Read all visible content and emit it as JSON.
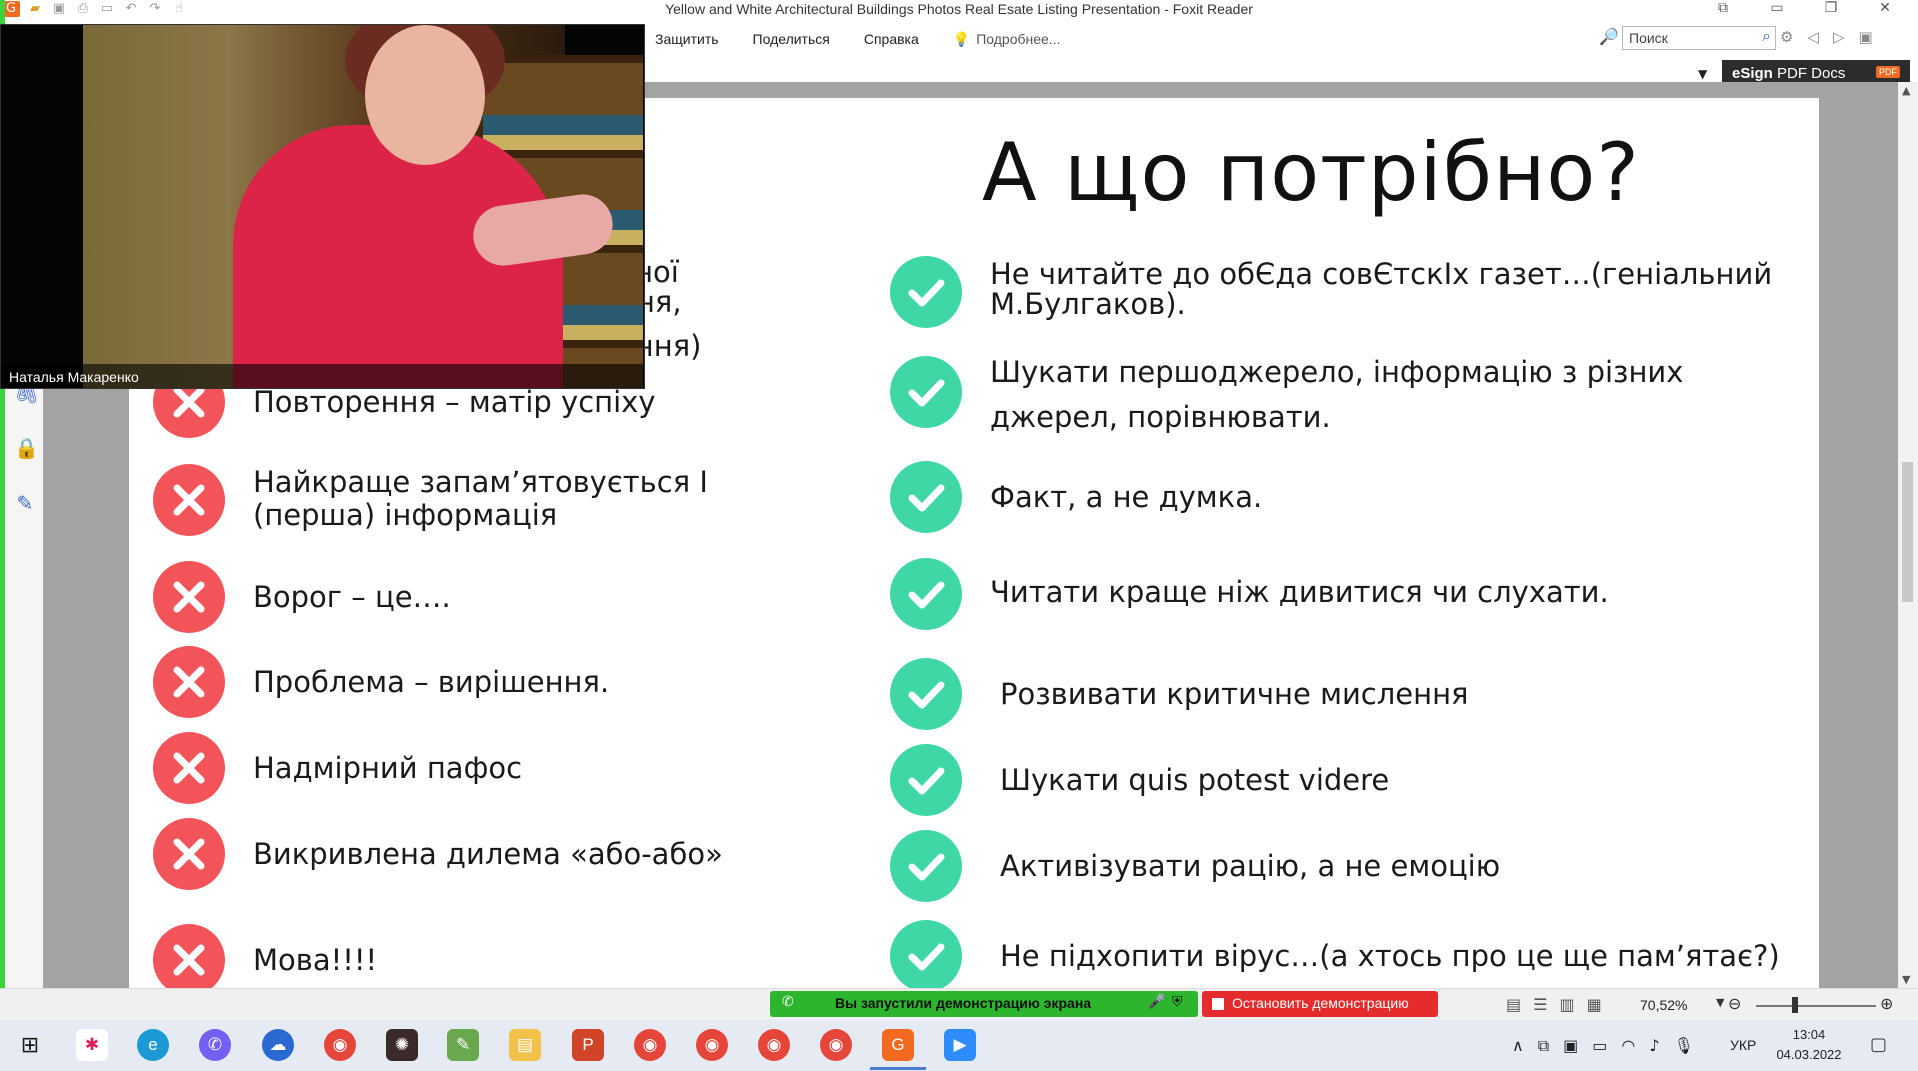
{
  "window": {
    "title": "Yellow and White Architectural Buildings Photos Real Esate Listing Presentation - Foxit Reader"
  },
  "menu": {
    "items": [
      "Защитить",
      "Поделиться",
      "Справка"
    ],
    "tell_me": "Подробнее..."
  },
  "search": {
    "placeholder": "Поиск"
  },
  "esign": {
    "label_bold": "eSign",
    "label": " PDF Docs",
    "badge": "PDF"
  },
  "webcam": {
    "name": "Наталья Макаренко"
  },
  "slide": {
    "title": "А що потрібно?",
    "left_hidden_fragments": [
      "вної",
      "ння,",
      "ання)"
    ],
    "left_items": [
      "Повторення – матір успіху",
      "Найкраще запам’ятовується I",
      "(перша) інформація",
      "Ворог – це….",
      "Проблема – вирішення.",
      "Надмірний пафос",
      "Викривлена дилема «або-або»",
      "Мова!!!!"
    ],
    "right_items": [
      "Не читайте до обЄда совЄтскIх газет…(геніальний",
      "М.Булгаков).",
      "Шукати першоджерело, інформацію з різних",
      "джерел, порівнювати.",
      "Факт, а не думка.",
      "Читати краще ніж дивитися чи слухати.",
      "Розвивати критичне мислення",
      "Шукати quis potest videre",
      "Активізувати рацію, а не емоцію",
      "Не підхопити вірус…(а хтось про це ще пам’ятає?)"
    ]
  },
  "statusbar": {
    "share_text": "Вы запустили демонстрацию экрана",
    "stop_text": "Остановить демонстрацию",
    "zoom": "70,52%"
  },
  "taskbar": {
    "lang": "УКР",
    "time": "13:04",
    "date": "04.03.2022"
  },
  "colors": {
    "cross_badge": "#f25459",
    "check_badge": "#3fd7a6",
    "share_green": "#2db52d",
    "stop_red": "#e52b2b"
  }
}
